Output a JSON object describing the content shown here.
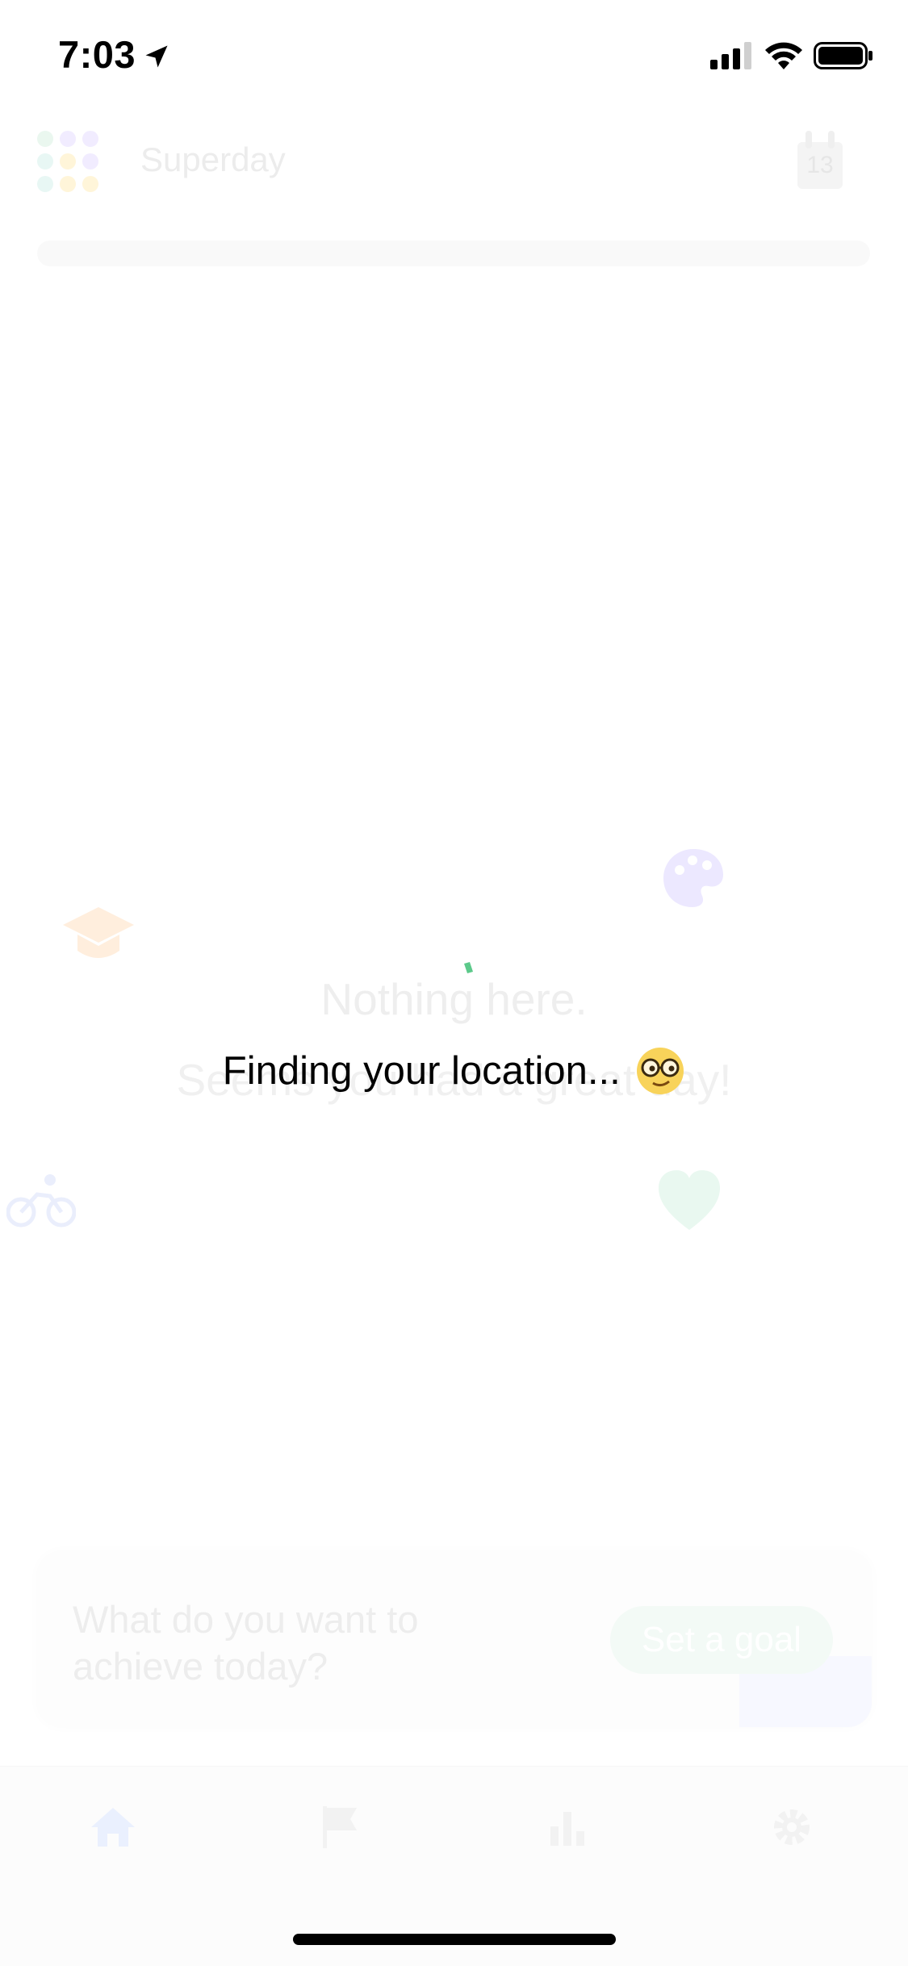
{
  "status_bar": {
    "time": "7:03",
    "icons": [
      "location-arrow-icon",
      "cellular-signal-icon",
      "wifi-icon",
      "battery-icon"
    ]
  },
  "header": {
    "app_title": "Superday",
    "calendar_day": "13"
  },
  "empty_state": {
    "title": "Nothing here.",
    "subtitle": "Seems you had a great day!",
    "icons": [
      "graduation-cap-icon",
      "palette-icon",
      "bicycle-icon",
      "heart-icon"
    ]
  },
  "overlay": {
    "message": "Finding your location...",
    "emoji": "nerd-face-icon"
  },
  "goal_card": {
    "prompt": "What do you want to achieve today?",
    "button_label": "Set a goal"
  },
  "tab_bar": {
    "tabs": [
      "home-icon",
      "flag-icon",
      "bar-chart-icon",
      "gear-icon"
    ],
    "active_tab": "home-icon"
  },
  "colors": {
    "spinner": "#5cc98a",
    "palette_tint": "#ece8ff",
    "cap_tint": "#ffeedd",
    "heart_tint": "#e9f8f0",
    "bike_tint": "#eaeefc",
    "home_tint": "#eaf0fe"
  }
}
